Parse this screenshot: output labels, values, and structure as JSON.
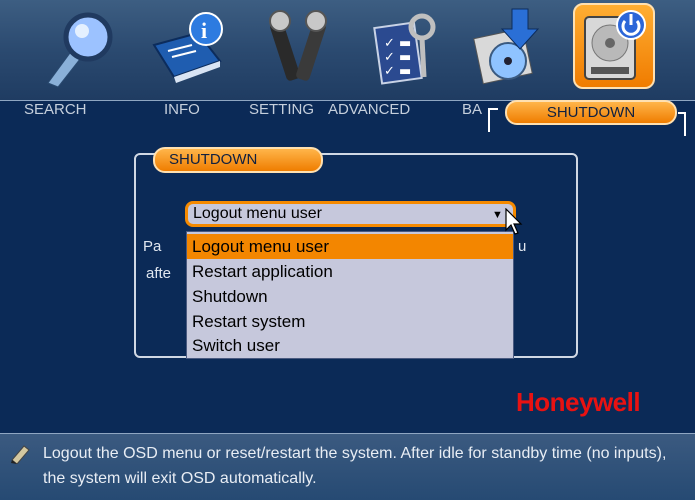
{
  "nav": {
    "items": [
      {
        "label": "SEARCH",
        "icon": "search-magnifier-icon"
      },
      {
        "label": "INFO",
        "icon": "info-book-icon"
      },
      {
        "label": "SETTING",
        "icon": "tools-wrench-icon"
      },
      {
        "label": "ADVANCED",
        "icon": "checklist-keys-icon"
      },
      {
        "label": "BA",
        "icon": "backup-disc-icon"
      },
      {
        "label": "SHUTDOWN",
        "icon": "power-drive-icon"
      }
    ],
    "active_tab": "SHUTDOWN"
  },
  "panel": {
    "title": "SHUTDOWN",
    "select_value": "Logout menu user",
    "background_text_1": "Pa",
    "background_text_1_right": "u",
    "background_text_2": "afte",
    "options": [
      "Logout menu user",
      "Restart application",
      "Shutdown",
      "Restart system",
      "Switch user"
    ],
    "highlighted_index": 0
  },
  "brand": "Honeywell",
  "footer": {
    "help_text": "Logout the OSD menu or reset/restart the system. After idle for standby time (no inputs), the system will exit OSD automatically."
  },
  "colors": {
    "accent": "#f38600",
    "background": "#0b2a57",
    "brand": "#e81212"
  }
}
